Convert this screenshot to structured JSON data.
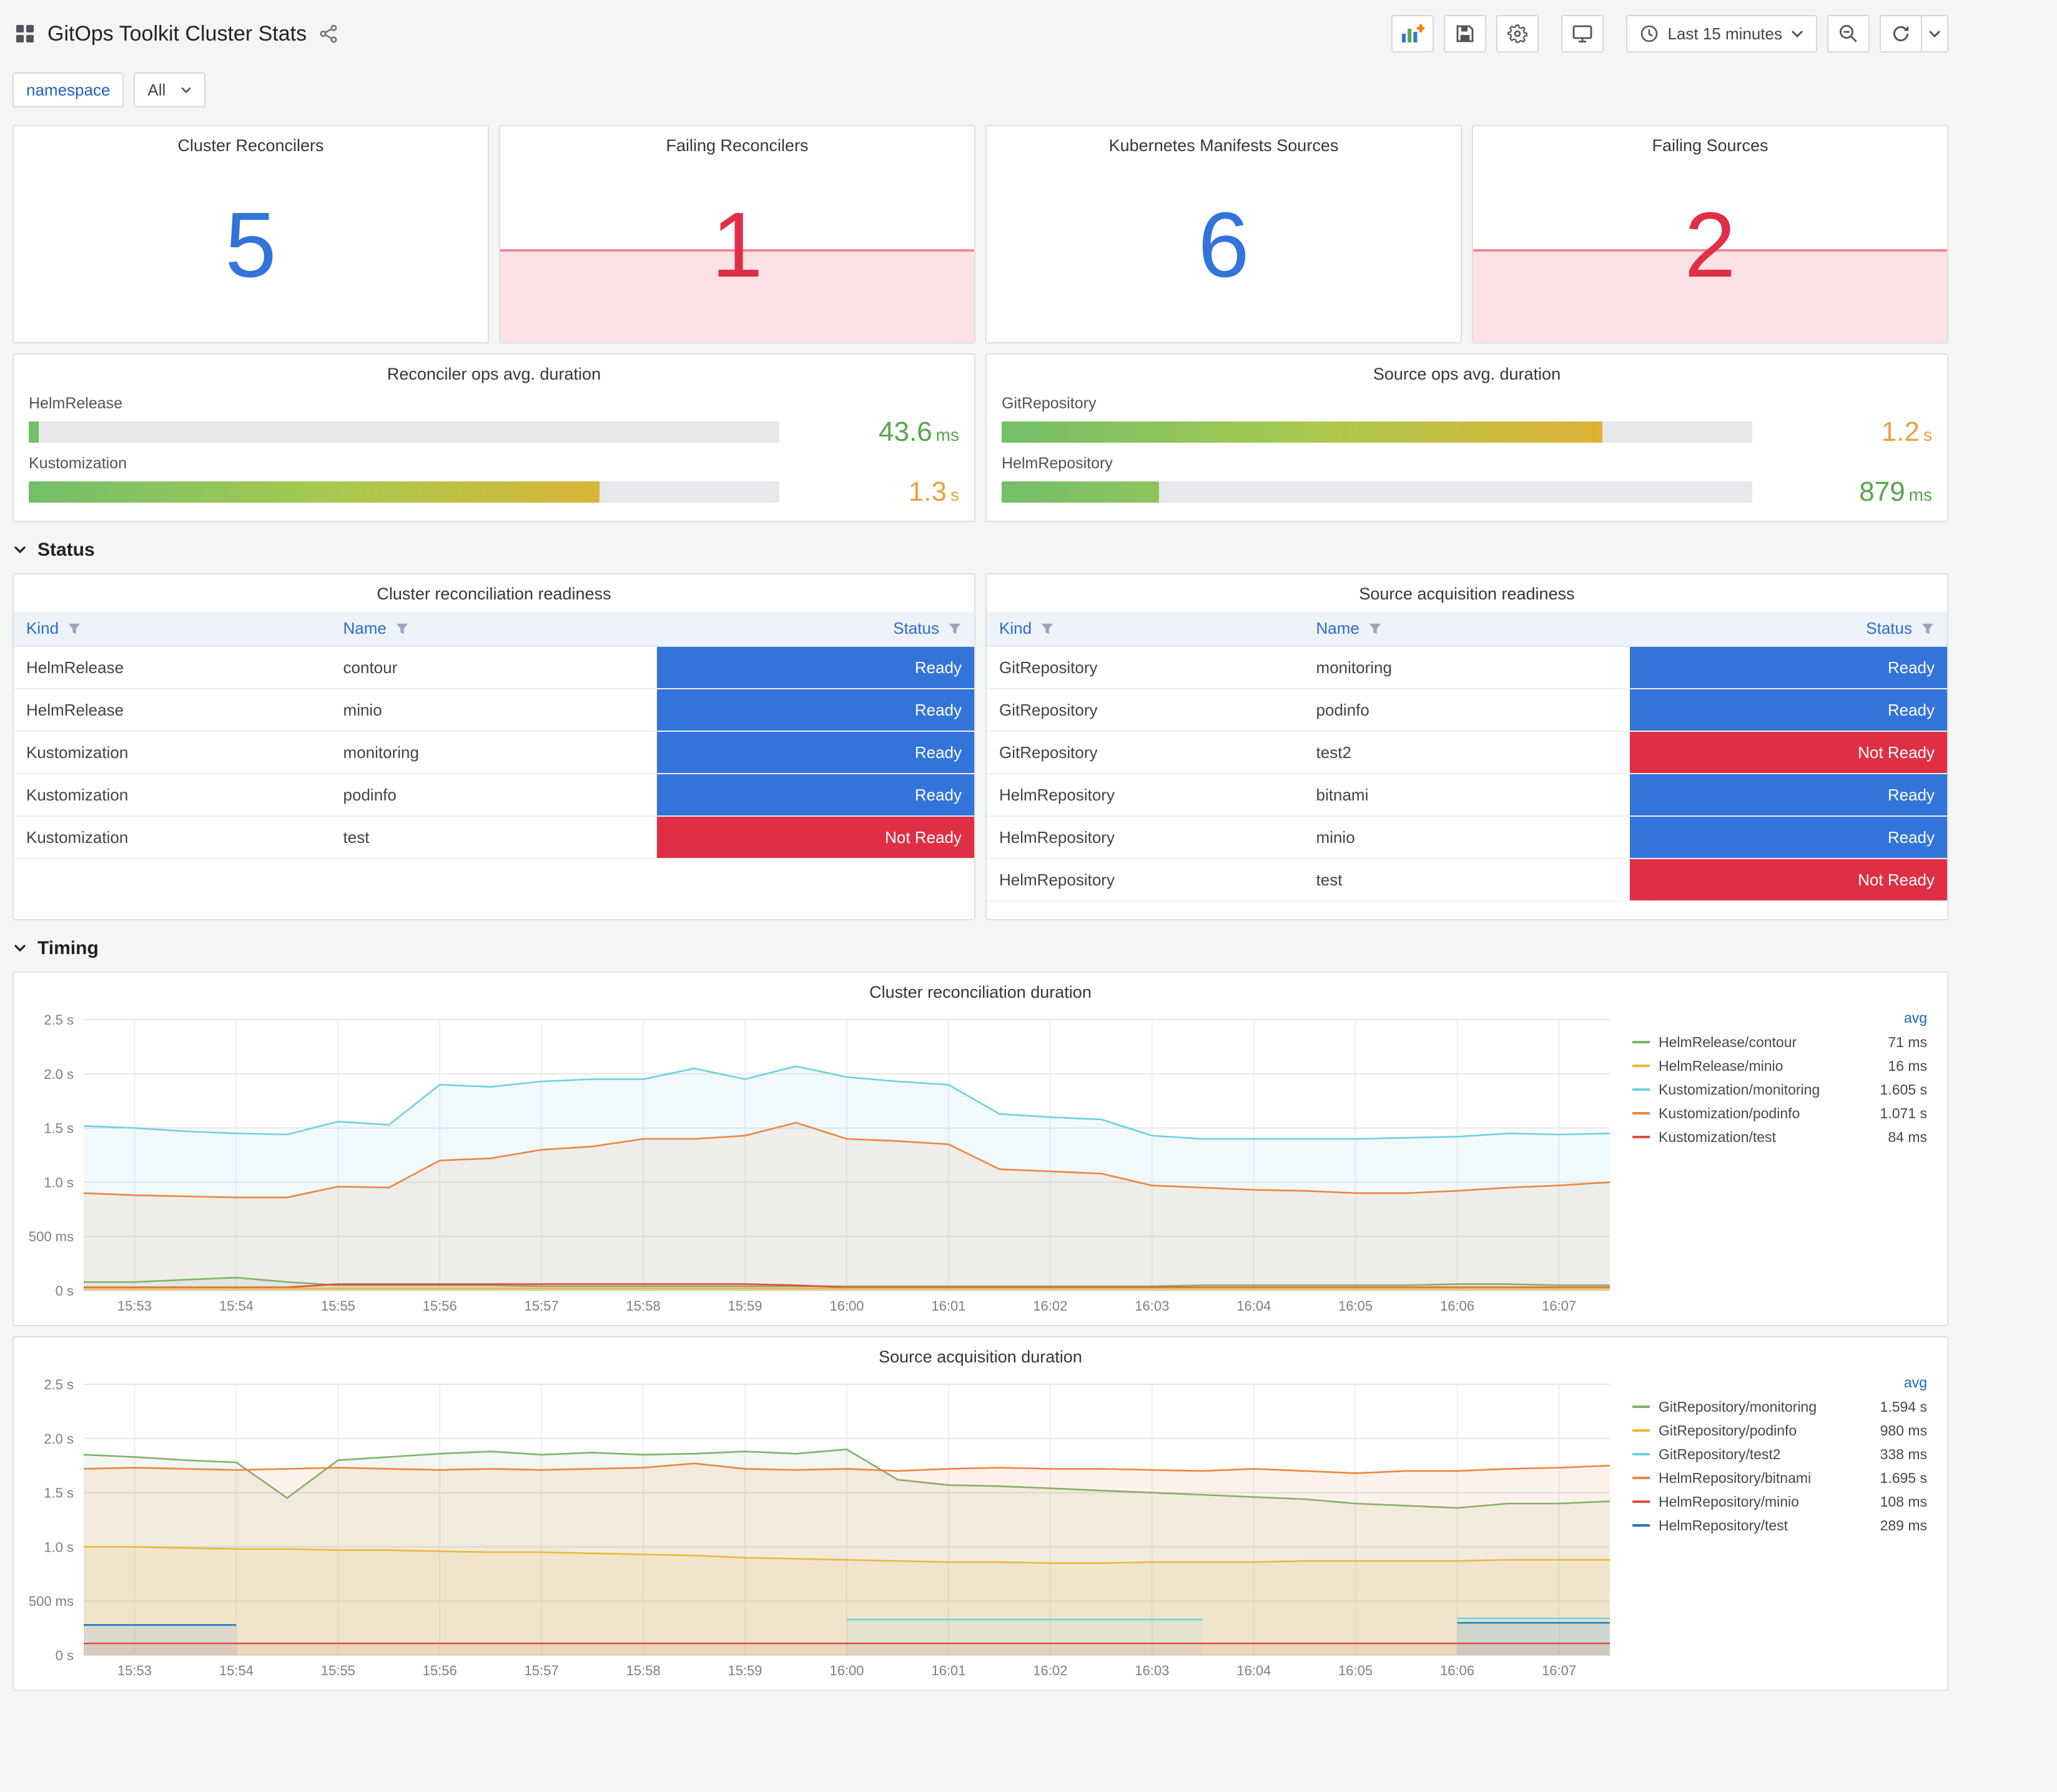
{
  "header": {
    "title": "GitOps Toolkit Cluster Stats",
    "time_picker": "Last 15 minutes"
  },
  "variables": {
    "label": "namespace",
    "value": "All"
  },
  "colors": {
    "accent_blue": "#3274D9",
    "alert_red": "#E02F44",
    "green_text": "#56A64B",
    "amber_text": "#E8A33C"
  },
  "stats": [
    {
      "title": "Cluster Reconcilers",
      "value": "5",
      "state": "ok"
    },
    {
      "title": "Failing Reconcilers",
      "value": "1",
      "state": "alert"
    },
    {
      "title": "Kubernetes Manifests Sources",
      "value": "6",
      "state": "ok"
    },
    {
      "title": "Failing Sources",
      "value": "2",
      "state": "alert"
    }
  ],
  "gauges": [
    {
      "title": "Reconciler ops avg. duration",
      "rows": [
        {
          "label": "HelmRelease",
          "value": "43.6",
          "unit": "ms",
          "pct": 1.3,
          "value_color": "#56A64B"
        },
        {
          "label": "Kustomization",
          "value": "1.3",
          "unit": "s",
          "pct": 76,
          "value_color": "#E8A33C"
        }
      ]
    },
    {
      "title": "Source ops avg. duration",
      "rows": [
        {
          "label": "GitRepository",
          "value": "1.2",
          "unit": "s",
          "pct": 80,
          "value_color": "#E8A33C"
        },
        {
          "label": "HelmRepository",
          "value": "879",
          "unit": "ms",
          "pct": 21,
          "value_color": "#56A64B"
        }
      ]
    }
  ],
  "sections": {
    "status": "Status",
    "timing": "Timing"
  },
  "status_colors": {
    "Ready": "#3274D9",
    "Not Ready": "#E02F44"
  },
  "tables": [
    {
      "title": "Cluster reconciliation readiness",
      "columns": [
        "Kind",
        "Name",
        "Status"
      ],
      "rows": [
        [
          "HelmRelease",
          "contour",
          "Ready"
        ],
        [
          "HelmRelease",
          "minio",
          "Ready"
        ],
        [
          "Kustomization",
          "monitoring",
          "Ready"
        ],
        [
          "Kustomization",
          "podinfo",
          "Ready"
        ],
        [
          "Kustomization",
          "test",
          "Not Ready"
        ]
      ]
    },
    {
      "title": "Source acquisition readiness",
      "columns": [
        "Kind",
        "Name",
        "Status"
      ],
      "rows": [
        [
          "GitRepository",
          "monitoring",
          "Ready"
        ],
        [
          "GitRepository",
          "podinfo",
          "Ready"
        ],
        [
          "GitRepository",
          "test2",
          "Not Ready"
        ],
        [
          "HelmRepository",
          "bitnami",
          "Ready"
        ],
        [
          "HelmRepository",
          "minio",
          "Ready"
        ],
        [
          "HelmRepository",
          "test",
          "Not Ready"
        ]
      ]
    }
  ],
  "chart_data": [
    {
      "type": "area",
      "title": "Cluster reconciliation duration",
      "legend_header": "avg",
      "legend_position": "right",
      "grid": true,
      "ylim": [
        0,
        2.5
      ],
      "ytick_values": [
        0,
        0.5,
        1.0,
        1.5,
        2.0,
        2.5
      ],
      "ytick_labels": [
        "0 s",
        "500 ms",
        "1.0 s",
        "1.5 s",
        "2.0 s",
        "2.5 s"
      ],
      "x_start": "15:52:30",
      "x_end": "16:07:30",
      "x_step_seconds": 30,
      "xtick_labels": [
        "15:53",
        "15:54",
        "15:55",
        "15:56",
        "15:57",
        "15:58",
        "15:59",
        "16:00",
        "16:01",
        "16:02",
        "16:03",
        "16:04",
        "16:05",
        "16:06",
        "16:07"
      ],
      "series": [
        {
          "name": "Kustomization/monitoring",
          "avg": "1.605 s",
          "color": "#6ED0E0",
          "values": [
            1.52,
            1.5,
            1.47,
            1.45,
            1.44,
            1.56,
            1.53,
            1.9,
            1.88,
            1.93,
            1.95,
            1.95,
            2.05,
            1.95,
            2.07,
            1.97,
            1.93,
            1.9,
            1.63,
            1.6,
            1.58,
            1.43,
            1.4,
            1.4,
            1.4,
            1.4,
            1.41,
            1.42,
            1.45,
            1.44,
            1.45
          ]
        },
        {
          "name": "Kustomization/podinfo",
          "avg": "1.071 s",
          "color": "#EF843C",
          "values": [
            0.9,
            0.88,
            0.87,
            0.86,
            0.86,
            0.96,
            0.95,
            1.2,
            1.22,
            1.3,
            1.33,
            1.4,
            1.4,
            1.43,
            1.55,
            1.4,
            1.38,
            1.35,
            1.12,
            1.1,
            1.08,
            0.97,
            0.95,
            0.93,
            0.92,
            0.9,
            0.9,
            0.92,
            0.95,
            0.97,
            1.0
          ]
        },
        {
          "name": "HelmRelease/contour",
          "avg": "71 ms",
          "color": "#7EB26D",
          "values": [
            0.08,
            0.08,
            0.1,
            0.12,
            0.08,
            0.05,
            0.05,
            0.05,
            0.05,
            0.04,
            0.04,
            0.04,
            0.04,
            0.04,
            0.04,
            0.04,
            0.04,
            0.04,
            0.04,
            0.04,
            0.04,
            0.04,
            0.05,
            0.05,
            0.05,
            0.05,
            0.05,
            0.06,
            0.06,
            0.05,
            0.05
          ]
        },
        {
          "name": "Kustomization/test",
          "avg": "84 ms",
          "color": "#E24D42",
          "values": [
            0.03,
            0.03,
            0.03,
            0.03,
            0.03,
            0.06,
            0.06,
            0.06,
            0.06,
            0.06,
            0.06,
            0.06,
            0.06,
            0.06,
            0.05,
            0.03,
            0.03,
            0.03,
            0.03,
            0.03,
            0.03,
            0.03,
            0.03,
            0.03,
            0.03,
            0.03,
            0.03,
            0.03,
            0.03,
            0.03,
            0.03
          ]
        },
        {
          "name": "HelmRelease/minio",
          "avg": "16 ms",
          "color": "#EAB839",
          "values": [
            0.02,
            0.02,
            0.02,
            0.02,
            0.02,
            0.02,
            0.02,
            0.02,
            0.02,
            0.02,
            0.02,
            0.02,
            0.02,
            0.02,
            0.02,
            0.02,
            0.02,
            0.02,
            0.02,
            0.02,
            0.02,
            0.02,
            0.02,
            0.02,
            0.02,
            0.02,
            0.02,
            0.02,
            0.02,
            0.02,
            0.02
          ]
        }
      ],
      "legend_order": [
        "HelmRelease/contour",
        "HelmRelease/minio",
        "Kustomization/monitoring",
        "Kustomization/podinfo",
        "Kustomization/test"
      ]
    },
    {
      "type": "area",
      "title": "Source acquisition duration",
      "legend_header": "avg",
      "legend_position": "right",
      "grid": true,
      "ylim": [
        0,
        2.5
      ],
      "ytick_values": [
        0,
        0.5,
        1.0,
        1.5,
        2.0,
        2.5
      ],
      "ytick_labels": [
        "0 s",
        "500 ms",
        "1.0 s",
        "1.5 s",
        "2.0 s",
        "2.5 s"
      ],
      "x_start": "15:52:30",
      "x_end": "16:07:30",
      "x_step_seconds": 30,
      "xtick_labels": [
        "15:53",
        "15:54",
        "15:55",
        "15:56",
        "15:57",
        "15:58",
        "15:59",
        "16:00",
        "16:01",
        "16:02",
        "16:03",
        "16:04",
        "16:05",
        "16:06",
        "16:07"
      ],
      "series": [
        {
          "name": "GitRepository/monitoring",
          "avg": "1.594 s",
          "color": "#7EB26D",
          "values": [
            1.85,
            1.83,
            1.8,
            1.78,
            1.45,
            1.8,
            1.83,
            1.86,
            1.88,
            1.85,
            1.87,
            1.85,
            1.86,
            1.88,
            1.86,
            1.9,
            1.62,
            1.57,
            1.56,
            1.54,
            1.52,
            1.5,
            1.48,
            1.46,
            1.44,
            1.4,
            1.38,
            1.36,
            1.4,
            1.4,
            1.42
          ]
        },
        {
          "name": "HelmRepository/bitnami",
          "avg": "1.695 s",
          "color": "#EF843C",
          "values": [
            1.72,
            1.73,
            1.72,
            1.71,
            1.72,
            1.73,
            1.72,
            1.71,
            1.72,
            1.71,
            1.72,
            1.73,
            1.77,
            1.72,
            1.71,
            1.72,
            1.7,
            1.72,
            1.73,
            1.72,
            1.72,
            1.71,
            1.7,
            1.72,
            1.7,
            1.68,
            1.7,
            1.7,
            1.72,
            1.73,
            1.75
          ]
        },
        {
          "name": "GitRepository/podinfo",
          "avg": "980 ms",
          "color": "#EAB839",
          "values": [
            1.0,
            1.0,
            0.99,
            0.98,
            0.98,
            0.97,
            0.97,
            0.96,
            0.95,
            0.95,
            0.94,
            0.93,
            0.92,
            0.9,
            0.89,
            0.88,
            0.87,
            0.86,
            0.86,
            0.85,
            0.85,
            0.86,
            0.86,
            0.86,
            0.87,
            0.87,
            0.87,
            0.87,
            0.88,
            0.88,
            0.88
          ]
        },
        {
          "name": "GitRepository/test2",
          "avg": "338 ms",
          "color": "#6ED0E0",
          "values": [
            null,
            null,
            null,
            null,
            null,
            null,
            null,
            null,
            null,
            null,
            null,
            null,
            null,
            null,
            null,
            0.33,
            0.33,
            0.33,
            0.33,
            0.33,
            0.33,
            0.33,
            0.33,
            null,
            null,
            null,
            null,
            0.34,
            0.34,
            0.34,
            0.34
          ]
        },
        {
          "name": "HelmRepository/test",
          "avg": "289 ms",
          "color": "#1F78C1",
          "values": [
            0.28,
            0.28,
            0.28,
            0.28,
            null,
            null,
            null,
            null,
            null,
            null,
            null,
            null,
            null,
            null,
            null,
            null,
            null,
            null,
            null,
            null,
            null,
            null,
            null,
            null,
            null,
            null,
            null,
            0.3,
            0.3,
            0.3,
            0.3
          ]
        },
        {
          "name": "HelmRepository/minio",
          "avg": "108 ms",
          "color": "#E24D42",
          "values": [
            0.11,
            0.11,
            0.11,
            0.11,
            0.11,
            0.11,
            0.11,
            0.11,
            0.11,
            0.11,
            0.11,
            0.11,
            0.11,
            0.11,
            0.11,
            0.11,
            0.11,
            0.11,
            0.11,
            0.11,
            0.11,
            0.11,
            0.11,
            0.11,
            0.11,
            0.11,
            0.11,
            0.11,
            0.11,
            0.11,
            0.11
          ]
        }
      ],
      "legend_order": [
        "GitRepository/monitoring",
        "GitRepository/podinfo",
        "GitRepository/test2",
        "HelmRepository/bitnami",
        "HelmRepository/minio",
        "HelmRepository/test"
      ]
    }
  ]
}
